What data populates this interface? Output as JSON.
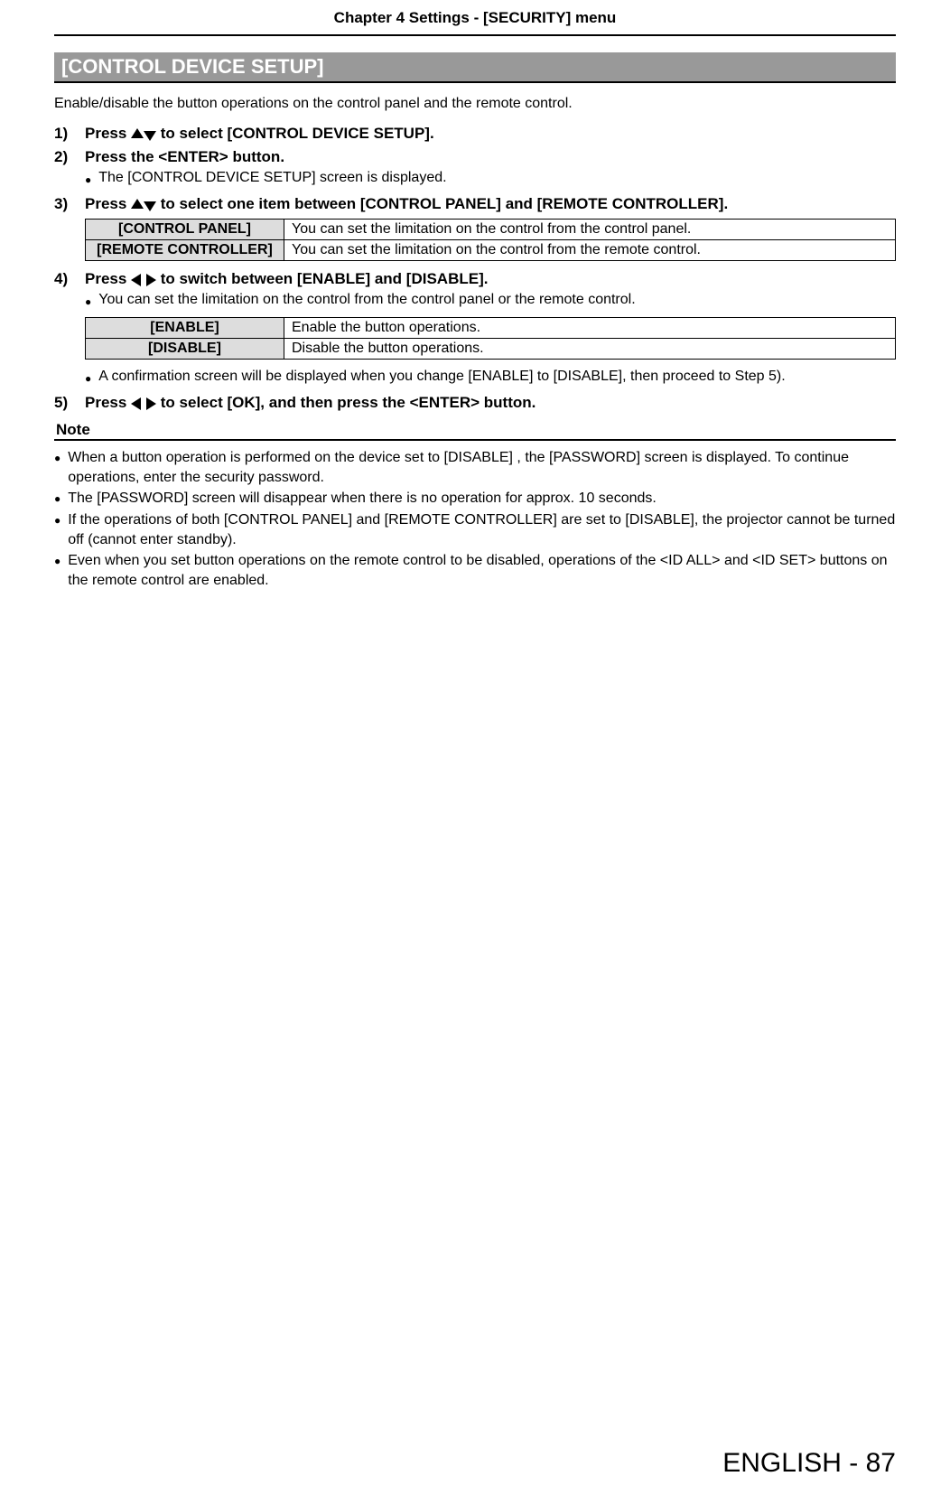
{
  "header": "Chapter 4   Settings - [SECURITY] menu",
  "section_title": "[CONTROL DEVICE SETUP]",
  "intro": "Enable/disable the button operations on the control panel and the remote control.",
  "steps": {
    "s1": {
      "num": "1)",
      "text": " to select [CONTROL DEVICE SETUP].",
      "prefix": "Press "
    },
    "s2": {
      "num": "2)",
      "text": "Press the <ENTER> button.",
      "sub": "The [CONTROL DEVICE SETUP] screen is displayed."
    },
    "s3": {
      "num": "3)",
      "prefix": "Press ",
      "text": " to select one item between [CONTROL PANEL] and [REMOTE CONTROLLER]."
    },
    "s4": {
      "num": "4)",
      "prefix": "Press ",
      "text": " to switch between [ENABLE] and [DISABLE].",
      "sub1": "You can set the limitation on the control from the control panel or the remote control.",
      "sub2": "A confirmation screen will be displayed when you change [ENABLE] to [DISABLE], then proceed to Step 5)."
    },
    "s5": {
      "num": "5)",
      "prefix": "Press ",
      "text": " to select [OK], and then press the <ENTER> button."
    }
  },
  "table1": {
    "r1": {
      "label": "[CONTROL PANEL]",
      "desc": "You can set the limitation on the control from the control panel."
    },
    "r2": {
      "label": "[REMOTE CONTROLLER]",
      "desc": "You can set the limitation on the control from the remote control."
    }
  },
  "table2": {
    "r1": {
      "label": "[ENABLE]",
      "desc": "Enable the button operations."
    },
    "r2": {
      "label": "[DISABLE]",
      "desc": "Disable the button operations."
    }
  },
  "note_heading": "Note",
  "notes": {
    "n1": "When a button operation is performed on the device set to [DISABLE] , the [PASSWORD] screen is displayed. To continue operations, enter the security password.",
    "n2": "The [PASSWORD] screen will disappear when there is no operation for approx. 10 seconds.",
    "n3": "If the operations of both [CONTROL PANEL] and [REMOTE CONTROLLER] are set to [DISABLE], the projector cannot be turned off (cannot enter standby).",
    "n4": "Even when you set button operations on the remote control to be disabled, operations of the <ID ALL> and <ID SET> buttons on the remote control are enabled."
  },
  "footer": {
    "lang": "ENGLISH - ",
    "page": "87"
  }
}
